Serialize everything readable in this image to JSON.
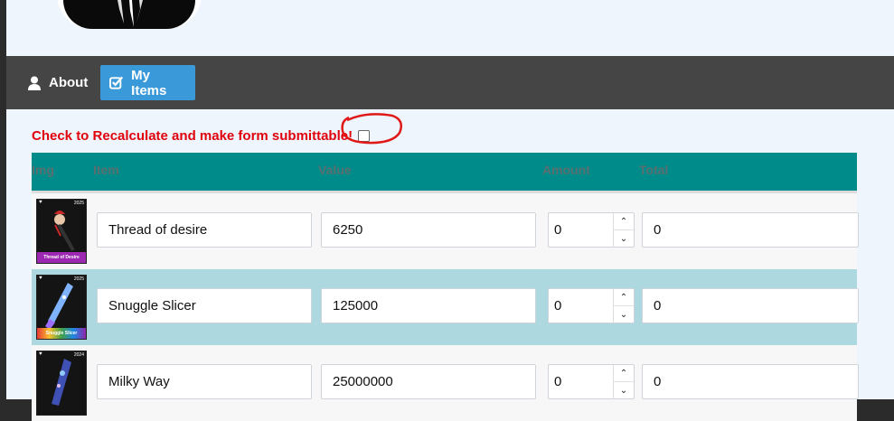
{
  "nav": {
    "about_label": "About",
    "myitems_label": "My Items",
    "active_color": "#3a9ad9"
  },
  "form": {
    "recalc_label": "Check to Recalculate and make form submittable!",
    "recalc_checked": false
  },
  "table": {
    "headers": [
      "Img",
      "Item",
      "Value",
      "Amount",
      "Total"
    ],
    "rows": [
      {
        "thumb_year": "2025",
        "thumb_caption": "Thread of Desire",
        "item": "Thread of desire",
        "value": "6250",
        "amount": "0",
        "total": "0"
      },
      {
        "thumb_year": "2025",
        "thumb_caption": "Snuggle Slicer",
        "item": "Snuggle Slicer",
        "value": "125000",
        "amount": "0",
        "total": "0"
      },
      {
        "thumb_year": "2024",
        "thumb_caption": "",
        "item": "Milky Way",
        "value": "25000000",
        "amount": "0",
        "total": "0"
      }
    ]
  },
  "colors": {
    "header_bg": "#008b8b",
    "row_alt_bg": "#add8e0",
    "recalc_text": "#e0000b",
    "navbar_bg": "#454545"
  }
}
